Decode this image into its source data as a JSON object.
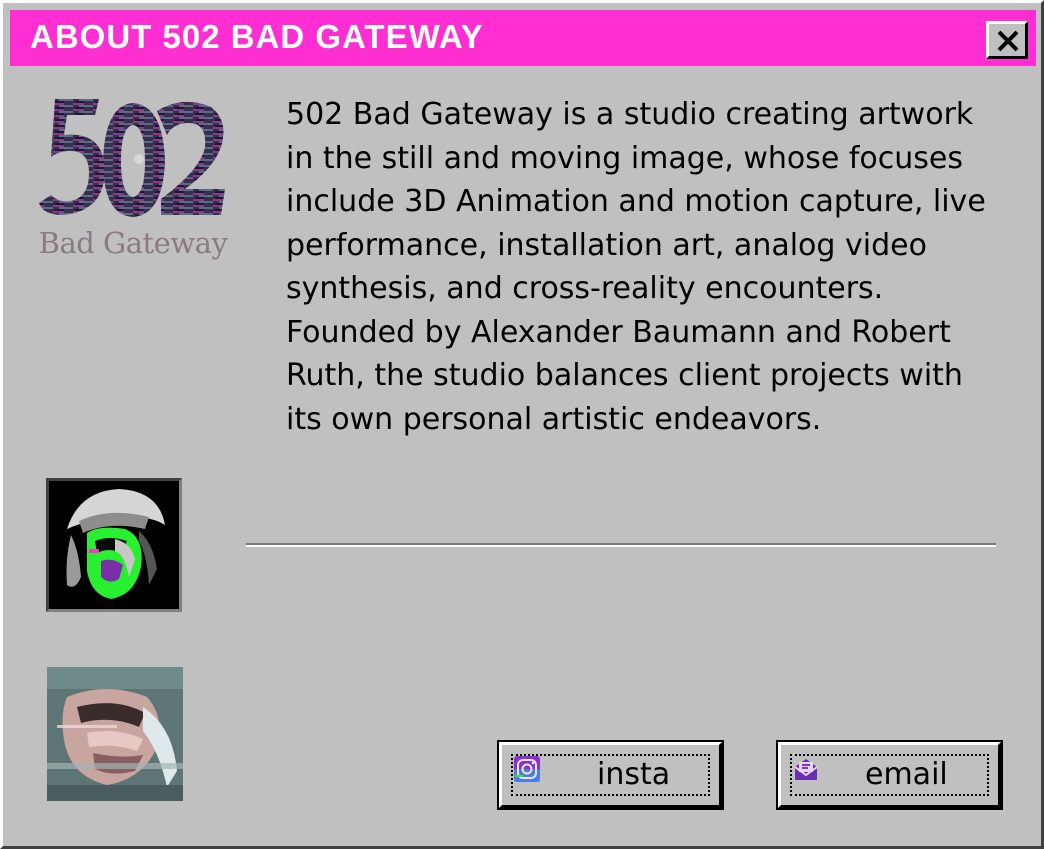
{
  "window": {
    "title": "ABOUT 502 BAD GATEWAY",
    "close_symbol": "✕"
  },
  "logo": {
    "caption": "Bad Gateway"
  },
  "about": {
    "paragraph_1": "502 Bad Gateway is a studio creating artwork in the still and moving image, whose focuses include 3D Animation and motion capture, live performance, installation art, analog video synthesis, and cross-reality encounters.",
    "paragraph_2": "Founded by Alexander Baumann and Robert Ruth, the studio balances client projects with its own personal artistic endeavors."
  },
  "buttons": {
    "insta_label": "insta",
    "email_label": "email"
  },
  "colors": {
    "titlebar": "#ff2ed2",
    "window_bg": "#c0c0c0",
    "accent_green": "#28f030",
    "accent_purple": "#8a2fd0"
  },
  "icons": {
    "close": "close-icon",
    "insta": "instagram-icon",
    "email": "envelope-icon"
  }
}
